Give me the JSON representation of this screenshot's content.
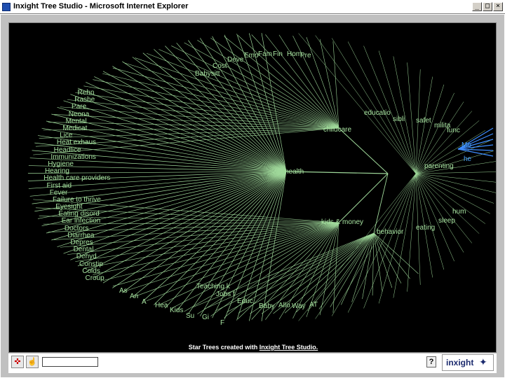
{
  "window": {
    "title": "Inxight Tree Studio - Microsoft Internet Explorer"
  },
  "footer": {
    "prefix": "Star Trees created with ",
    "link": "Inxight Tree Studio."
  },
  "logo": {
    "text": "inxight"
  },
  "toolbar": {
    "search_value": ""
  },
  "colors": {
    "branch": "#9fd89a",
    "background": "#000000",
    "highlight": "#3e8cff"
  },
  "icons": {
    "target_tool": "crosshair-icon",
    "hand_tool": "hand-icon",
    "help": "help-icon",
    "window_min": "minimize-icon",
    "window_max": "maximize-icon",
    "window_close": "close-icon"
  },
  "tree": {
    "hubs": [
      "health",
      "childcare",
      "educatio",
      "sibli",
      "safet",
      "milita",
      "func",
      "parenting",
      "kids & money",
      "behavior",
      "eating",
      "sleep",
      "hum",
      "Mo",
      "he"
    ],
    "left_labels": [
      "Rehn",
      "Rashe",
      "Pare",
      "Neona",
      "Mental",
      "Medicat",
      "Lice",
      "Heat exhaus",
      "Headlice",
      "Immunizations",
      "Hygiene",
      "Hearing",
      "Health care providers",
      "First aid",
      "Fever",
      "Failure to thrive",
      "Eyesight",
      "Eating disord",
      "Ear infection",
      "Doctors",
      "Diarrhea",
      "Depres",
      "Dental",
      "Dehyd",
      "Constip",
      "Colds",
      "Croup"
    ],
    "top_labels": [
      "Babysitt",
      "Cost",
      "Deve",
      "Emo",
      "Fam",
      "Fin",
      "Hom",
      "Pre"
    ],
    "bottom_labels": [
      "Teaching k",
      "Jobs f",
      "Educ",
      "Baby",
      "Allo",
      "Way",
      "AT",
      "As",
      "An",
      "A",
      "Hea",
      "Kids",
      "Su",
      "Gi",
      "F"
    ]
  }
}
